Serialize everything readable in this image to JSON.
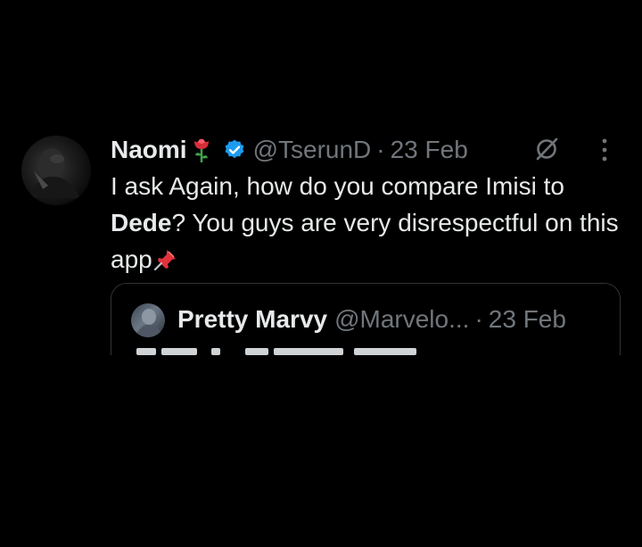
{
  "tweet": {
    "author_name": "Naomi",
    "author_name_emoji": "rose-emoji",
    "verified_icon": "verified-badge-icon",
    "handle": "@TserunD",
    "separator": "·",
    "date": "23 Feb",
    "grok_icon": "grok-icon",
    "more_icon": "more-dots-icon",
    "text_part1": "I ask Again, how do you compare Imisi to ",
    "text_bold": "Dede",
    "text_part2": "? You guys are very disrespectful on this app",
    "text_emoji": "pushpin-emoji"
  },
  "quoted_tweet": {
    "author_name": "Pretty Marvy",
    "handle": "@Marvelo...",
    "separator": "·",
    "date": "23 Feb"
  },
  "colors": {
    "background": "#000000",
    "primary_text": "#e7e9ea",
    "secondary_text": "#71767b",
    "verified_blue": "#1d9bf0",
    "border": "#2f3336"
  }
}
